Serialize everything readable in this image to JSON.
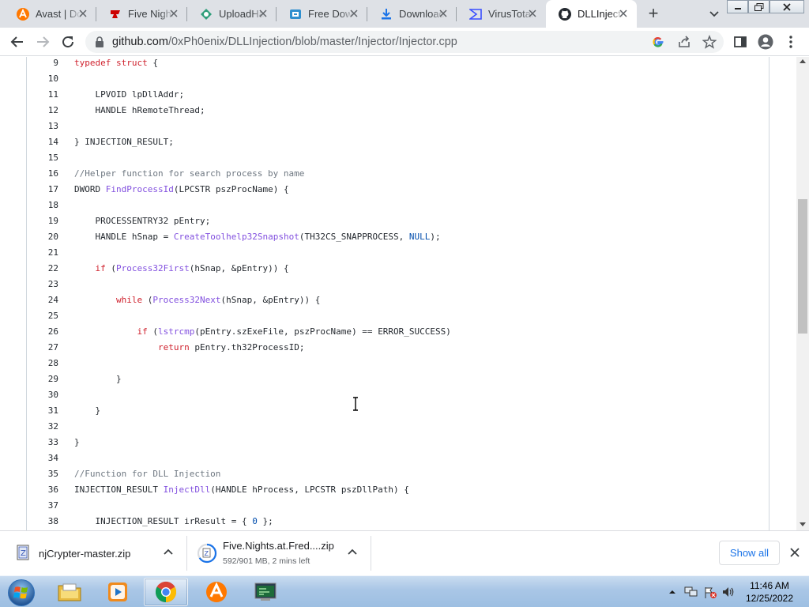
{
  "browser": {
    "tabs": [
      {
        "title": "Avast | Download Free Antivirus",
        "icon": "avast-icon",
        "active": false
      },
      {
        "title": "Five Nights at Freddy's",
        "icon": "gamejolt-icon",
        "active": false
      },
      {
        "title": "UploadHaven",
        "icon": "uploadhaven-icon",
        "active": false
      },
      {
        "title": "Free Download",
        "icon": "free-download-icon",
        "active": false
      },
      {
        "title": "Download",
        "icon": "download-icon",
        "active": false
      },
      {
        "title": "VirusTotal",
        "icon": "virustotal-icon",
        "active": false
      },
      {
        "title": "DLLInjection",
        "icon": "github-icon",
        "active": true
      }
    ],
    "address": {
      "host": "github.com",
      "path": "/0xPh0enix/DLLInjection/blob/master/Injector/Injector.cpp"
    }
  },
  "code": {
    "lines": [
      {
        "n": "9",
        "text": "typedef struct {"
      },
      {
        "n": "10",
        "text": ""
      },
      {
        "n": "11",
        "text": "    LPVOID lpDllAddr;"
      },
      {
        "n": "12",
        "text": "    HANDLE hRemoteThread;"
      },
      {
        "n": "13",
        "text": ""
      },
      {
        "n": "14",
        "text": "} INJECTION_RESULT;"
      },
      {
        "n": "15",
        "text": ""
      },
      {
        "n": "16",
        "text": "//Helper function for search process by name"
      },
      {
        "n": "17",
        "text": "DWORD FindProcessId(LPCSTR pszProcName) {"
      },
      {
        "n": "18",
        "text": ""
      },
      {
        "n": "19",
        "text": "    PROCESSENTRY32 pEntry;"
      },
      {
        "n": "20",
        "text": "    HANDLE hSnap = CreateToolhelp32Snapshot(TH32CS_SNAPPROCESS, NULL);"
      },
      {
        "n": "21",
        "text": ""
      },
      {
        "n": "22",
        "text": "    if (Process32First(hSnap, &pEntry)) {"
      },
      {
        "n": "23",
        "text": ""
      },
      {
        "n": "24",
        "text": "        while (Process32Next(hSnap, &pEntry)) {"
      },
      {
        "n": "25",
        "text": ""
      },
      {
        "n": "26",
        "text": "            if (lstrcmp(pEntry.szExeFile, pszProcName) == ERROR_SUCCESS)"
      },
      {
        "n": "27",
        "text": "                return pEntry.th32ProcessID;"
      },
      {
        "n": "28",
        "text": ""
      },
      {
        "n": "29",
        "text": "        }"
      },
      {
        "n": "30",
        "text": ""
      },
      {
        "n": "31",
        "text": "    }"
      },
      {
        "n": "32",
        "text": ""
      },
      {
        "n": "33",
        "text": "}"
      },
      {
        "n": "34",
        "text": ""
      },
      {
        "n": "35",
        "text": "//Function for DLL Injection"
      },
      {
        "n": "36",
        "text": "INJECTION_RESULT InjectDll(HANDLE hProcess, LPCSTR pszDllPath) {"
      },
      {
        "n": "37",
        "text": ""
      },
      {
        "n": "38",
        "text": "    INJECTION_RESULT irResult = { 0 };"
      }
    ],
    "keywords": [
      "typedef",
      "struct",
      "if",
      "while",
      "return"
    ],
    "functions": [
      "FindProcessId",
      "CreateToolhelp32Snapshot",
      "Process32First",
      "Process32Next",
      "lstrcmp",
      "InjectDll"
    ],
    "constants": [
      "NULL",
      "0"
    ]
  },
  "downloads": {
    "items": [
      {
        "name": "njCrypter-master.zip",
        "status": ""
      },
      {
        "name": "Five.Nights.at.Fred....zip",
        "status": "592/901 MB, 2 mins left",
        "progress": 0.657
      }
    ],
    "show_all": "Show all"
  },
  "taskbar": {
    "apps": [
      "explorer-icon",
      "media-player-icon",
      "chrome-icon",
      "avast-icon",
      "terminal-icon"
    ],
    "active_app": "chrome-icon",
    "time": "11:46 AM",
    "date": "12/25/2022"
  },
  "colors": {
    "keyword": "#cf222e",
    "function": "#8250df",
    "comment": "#6e7781",
    "constant": "#0550ae",
    "link": "#1a73e8"
  }
}
